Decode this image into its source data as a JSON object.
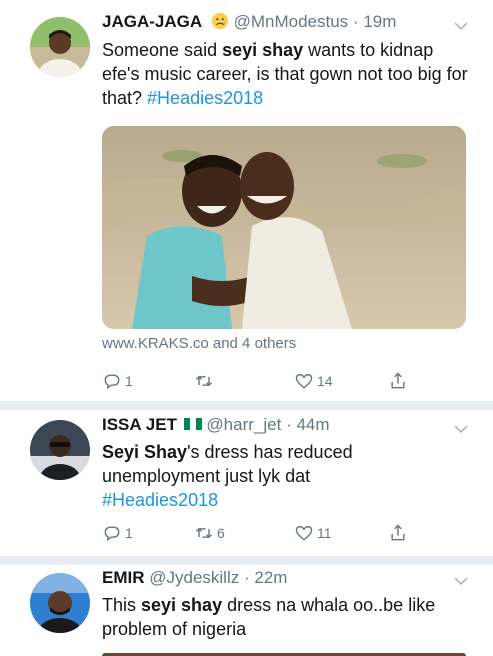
{
  "tweets": [
    {
      "name": "JAGA-JAGA",
      "handle": "@MnModestus",
      "dot": "·",
      "time": "19m",
      "emoji": "worried-face-emoji",
      "text": {
        "t1": "Someone said ",
        "b1": "seyi shay",
        "t2": " wants to kidnap efe's music career, is that gown not too big for that? ",
        "hashtag": "#Headies2018"
      },
      "card_source": "www.KRAKS.co and 4 others",
      "counts": {
        "reply": "1",
        "retweet": "",
        "like": "14"
      }
    },
    {
      "name": "ISSA JET",
      "handle": "@harr_jet",
      "dot": "·",
      "time": "44m",
      "emoji": "nigeria-flag-emoji",
      "text": {
        "b1": "Seyi Shay",
        "t2": "'s dress has reduced unemployment just lyk dat",
        "hashtag": "#Headies2018"
      },
      "counts": {
        "reply": "1",
        "retweet": "6",
        "like": "11"
      }
    },
    {
      "name": "EMIR",
      "handle": "@Jydeskillz",
      "dot": "·",
      "time": "22m",
      "text": {
        "t1": "This ",
        "b1": "seyi shay",
        "t2": " dress na whala oo..be like problem of nigeria"
      }
    }
  ],
  "colors": {
    "link": "#1b95e0",
    "muted": "#657786",
    "separator": "#e6ecf0",
    "nigeria_green": "#008751"
  },
  "icons": [
    "reply-icon",
    "retweet-icon",
    "like-icon",
    "share-icon",
    "chevron-down-icon"
  ]
}
